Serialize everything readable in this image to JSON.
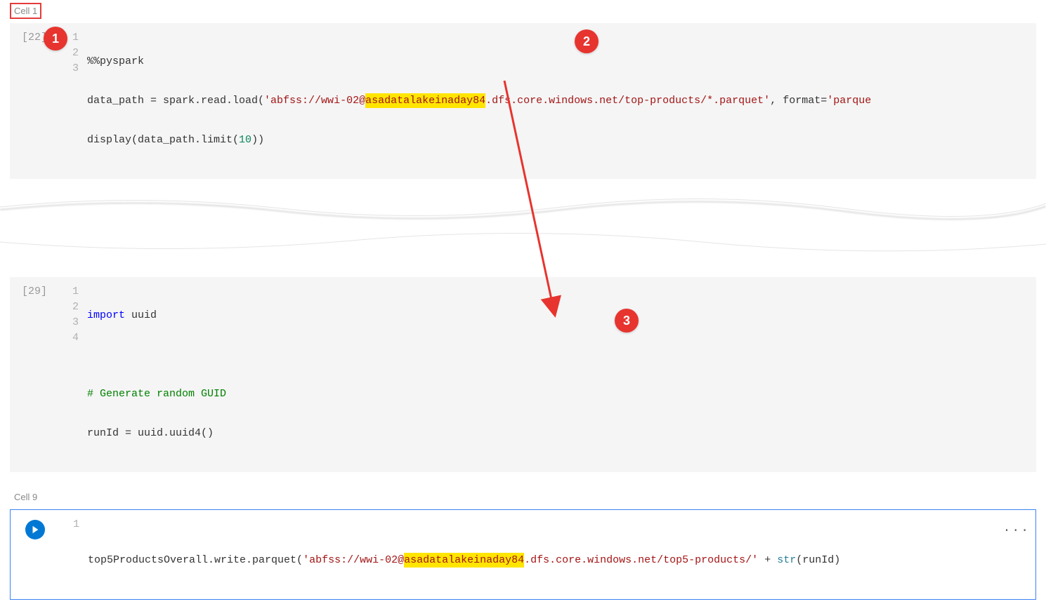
{
  "cell1": {
    "label": "Cell 1",
    "exec_count": "[22]",
    "lines": [
      "1",
      "2",
      "3"
    ],
    "magic": "%%pyspark",
    "var1": "data_path = spark.read.load(",
    "path_pre": "'abfss://wwi-02@",
    "path_hl": "asadatalakeinaday84",
    "path_post": ".dfs.core.windows.net/top-products/*.parquet'",
    "fmt_label": ", format=",
    "fmt_val": "'parque",
    "line3a": "display(data_path.limit(",
    "line3num": "10",
    "line3b": "))"
  },
  "cell2": {
    "exec_count": "[29]",
    "lines": [
      "1",
      "2",
      "3",
      "4"
    ],
    "l1_kw": "import",
    "l1_mod": " uuid",
    "l3": "# Generate random GUID",
    "l4": "runId = uuid.uuid4()"
  },
  "cell9": {
    "label": "Cell 9",
    "lines": [
      "1"
    ],
    "pre": "top5ProductsOverall.write.parquet(",
    "path_pre": "'abfss://wwi-02@",
    "path_hl": "asadatalakeinaday84",
    "path_post": ".dfs.core.windows.net/top5-products/'",
    "plus": " + ",
    "str_fn": "str",
    "tail": "(runId) "
  },
  "callouts": {
    "c1": "1",
    "c2": "2",
    "c3": "3"
  },
  "ellipsis": "···"
}
